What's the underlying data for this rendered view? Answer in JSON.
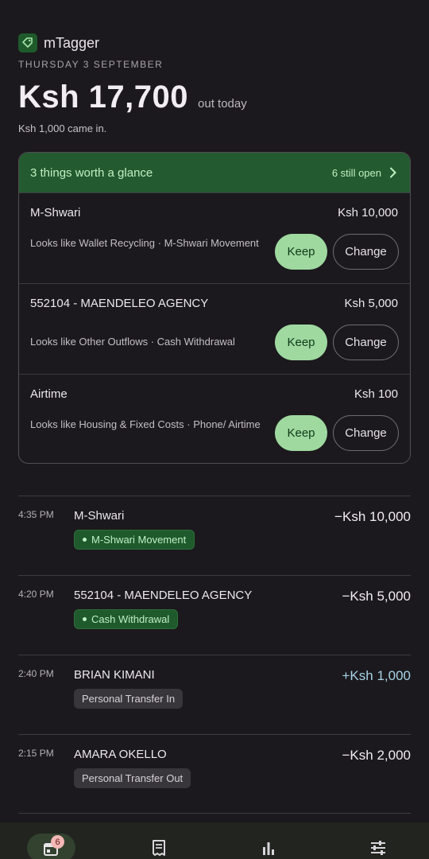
{
  "app": {
    "title": "mTagger"
  },
  "summary": {
    "date": "THURSDAY 3 SEPTEMBER",
    "total": "Ksh 17,700",
    "total_suffix": "out today",
    "came_in": "Ksh 1,000 came in."
  },
  "review": {
    "title": "3 things worth a glance",
    "open_label": "6 still open",
    "items": [
      {
        "name": "M-Shwari",
        "amount": "Ksh 10,000",
        "desc": "Looks like Wallet Recycling · M-Shwari Movement",
        "keep": "Keep",
        "change": "Change"
      },
      {
        "name": "552104 - MAENDELEO AGENCY",
        "amount": "Ksh 5,000",
        "desc": "Looks like Other Outflows · Cash Withdrawal",
        "keep": "Keep",
        "change": "Change"
      },
      {
        "name": "Airtime",
        "amount": "Ksh 100",
        "desc": "Looks like Housing & Fixed Costs · Phone/ Airtime",
        "keep": "Keep",
        "change": "Change"
      }
    ]
  },
  "transactions": [
    {
      "time": "4:35 PM",
      "name": "M-Shwari",
      "amount": "−Ksh 10,000",
      "tag": "M-Shwari Movement"
    },
    {
      "time": "4:20 PM",
      "name": "552104 - MAENDELEO AGENCY",
      "amount": "−Ksh 5,000",
      "tag": "Cash Withdrawal"
    },
    {
      "time": "2:40 PM",
      "name": "BRIAN KIMANI",
      "amount": "+Ksh 1,000",
      "tag": "Personal Transfer In"
    },
    {
      "time": "2:15 PM",
      "name": "AMARA OKELLO",
      "amount": "−Ksh 2,000",
      "tag": "Personal Transfer Out"
    }
  ],
  "nav": {
    "badge": "6",
    "items": [
      "calendar-day-icon",
      "receipt-icon",
      "bar-chart-icon",
      "sliders-icon"
    ]
  },
  "colors": {
    "background": "#1b191d",
    "accent_green": "#245a2f",
    "keep_button": "#9fd9a0",
    "income": "#a6d2e6",
    "badge": "#f2b8b5"
  }
}
